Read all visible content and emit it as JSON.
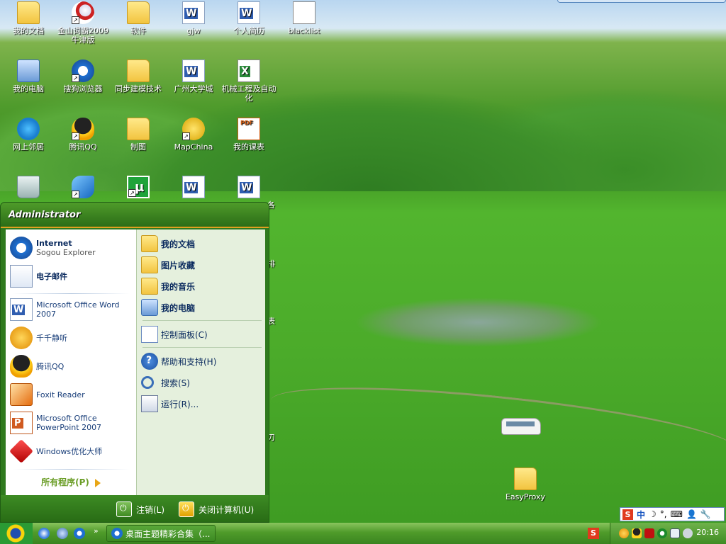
{
  "desktop": {
    "icons": [
      {
        "label": "我的文档",
        "icon": "my-documents-icon"
      },
      {
        "label": "金山词霸2009牛津版",
        "icon": "kingsoft-icon"
      },
      {
        "label": "软件",
        "icon": "folder-icon"
      },
      {
        "label": "gjw",
        "icon": "word-doc-icon"
      },
      {
        "label": "个人简历",
        "icon": "word-doc-icon"
      },
      {
        "label": "blacklist",
        "icon": "text-file-icon"
      },
      {
        "label": "我的电脑",
        "icon": "computer-icon"
      },
      {
        "label": "搜狗浏览器",
        "icon": "sogou-icon"
      },
      {
        "label": "同步建模技术",
        "icon": "folder-icon"
      },
      {
        "label": "广州大学城",
        "icon": "bmp-file-icon"
      },
      {
        "label": "机械工程及自动化",
        "icon": "excel-file-icon"
      },
      {
        "label": "网上邻居",
        "icon": "network-icon"
      },
      {
        "label": "腾讯QQ",
        "icon": "qq-icon"
      },
      {
        "label": "制图",
        "icon": "folder-icon"
      },
      {
        "label": "MapChina",
        "icon": "mapchina-icon"
      },
      {
        "label": "我的课表",
        "icon": "pdf-file-icon"
      },
      {
        "label": "EasyProxy",
        "icon": "folder-icon"
      }
    ],
    "partial_labels": [
      "各",
      "排",
      "表",
      "刃"
    ]
  },
  "start_menu": {
    "user": "Administrator",
    "pinned": [
      {
        "title": "Internet",
        "subtitle": "Sogou Explorer"
      },
      {
        "title": "电子邮件",
        "subtitle": ""
      }
    ],
    "recent": [
      {
        "label": "Microsoft Office Word 2007"
      },
      {
        "label": "千千静听"
      },
      {
        "label": "腾讯QQ"
      },
      {
        "label": "Foxit Reader"
      },
      {
        "label": "Microsoft Office PowerPoint 2007"
      },
      {
        "label": "Windows优化大师"
      }
    ],
    "all_programs": "所有程序(P)",
    "places": [
      {
        "label": "我的文档"
      },
      {
        "label": "图片收藏"
      },
      {
        "label": "我的音乐"
      },
      {
        "label": "我的电脑"
      }
    ],
    "control_panel": "控制面板(C)",
    "help": "帮助和支持(H)",
    "search": "搜索(S)",
    "run": "运行(R)...",
    "logoff": "注销(L)",
    "shutdown": "关闭计算机(U)"
  },
  "taskbar": {
    "quicklaunch_more": "»",
    "task": "桌面主题精彩合集（...",
    "tray_s": "S",
    "clock": "20:16"
  },
  "ime_bar": {
    "s": "S",
    "mode": "中",
    "moon": "☽",
    "punct": "°,",
    "keyboard": "⌨",
    "user": "👤",
    "tools": "🔧"
  }
}
